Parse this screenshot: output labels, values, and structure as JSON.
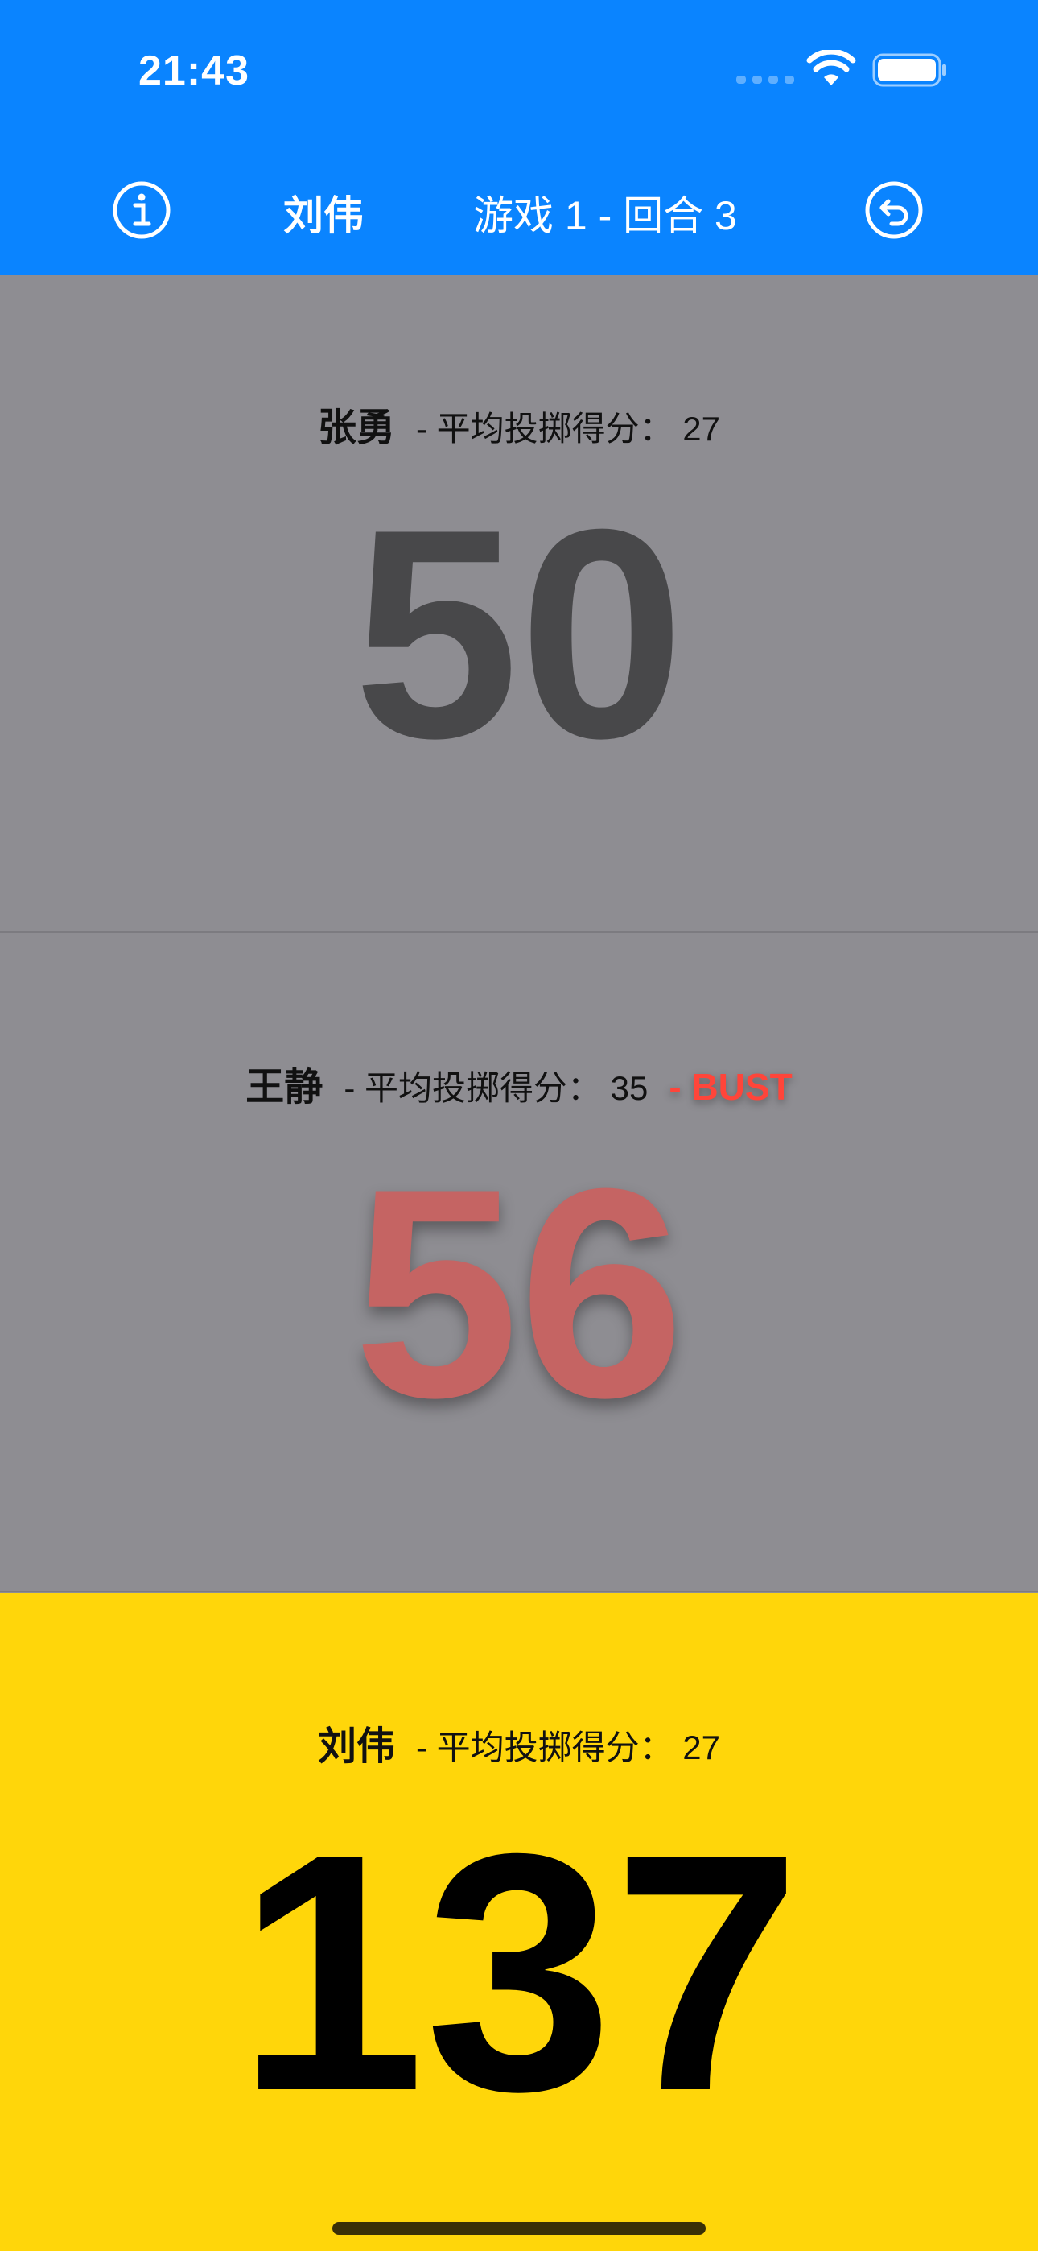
{
  "status_bar": {
    "time": "21:43"
  },
  "nav": {
    "current_player": "刘伟",
    "game_round": "游戏 1 - 回合 3",
    "info_icon": "info-circle-icon",
    "undo_icon": "undo-arrow-icon"
  },
  "players": [
    {
      "name": "张勇",
      "avg_text": "- 平均投掷得分： 27",
      "score": "50",
      "bust": ""
    },
    {
      "name": "王静",
      "avg_text": "- 平均投掷得分： 35",
      "score": "56",
      "bust": "- BUST"
    },
    {
      "name": "刘伟",
      "avg_text": "- 平均投掷得分： 27",
      "score": "137",
      "bust": ""
    }
  ],
  "colors": {
    "header": "#0a84ff",
    "inactive_panel": "#8e8d92",
    "active_panel": "#ffd60a",
    "bust": "#ff453a",
    "bust_score": "#c56463"
  }
}
